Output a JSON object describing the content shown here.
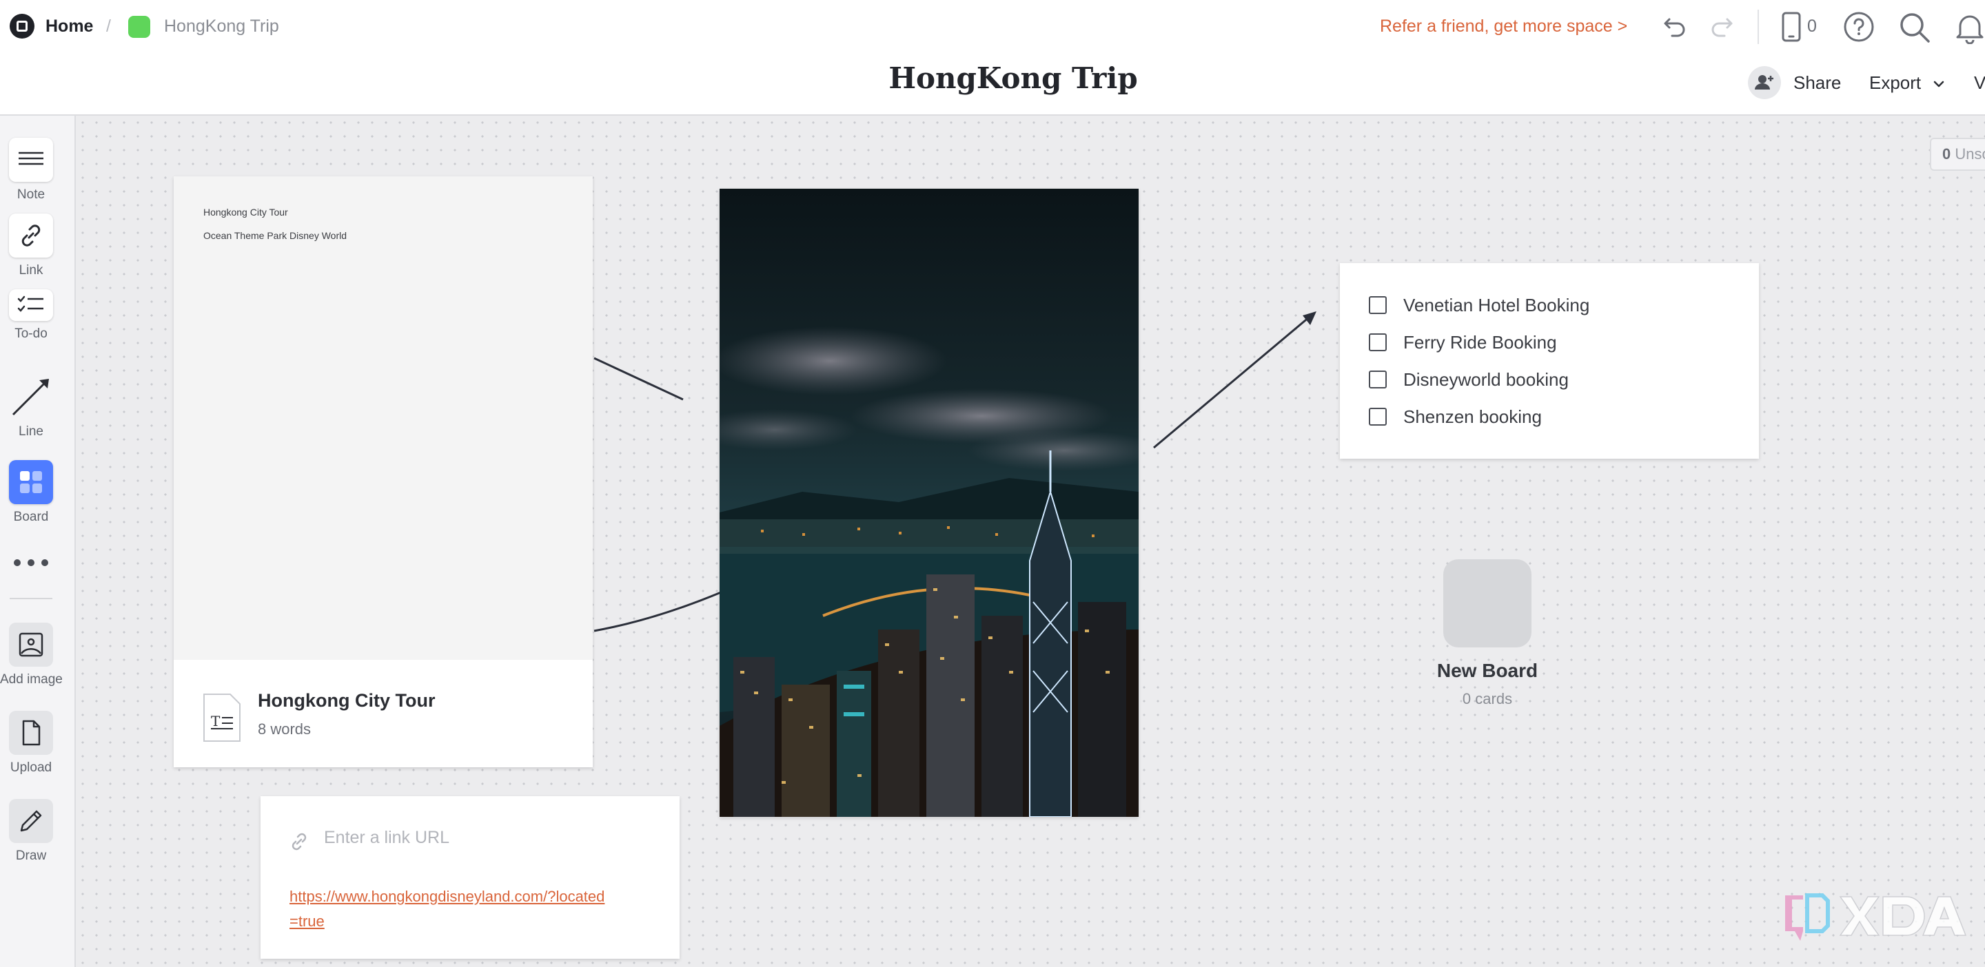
{
  "breadcrumb": {
    "home": "Home",
    "separator": "/",
    "board": "HongKong Trip",
    "board_color": "#5fd55a"
  },
  "header": {
    "refer": "Refer a friend, get more space >",
    "device_count": "0",
    "title": "HongKong Trip",
    "share": "Share",
    "export": "Export",
    "view": "V"
  },
  "sidebar": {
    "tools": [
      {
        "label": "Note",
        "icon": "note-icon"
      },
      {
        "label": "Link",
        "icon": "link-icon"
      },
      {
        "label": "To-do",
        "icon": "todo-icon"
      },
      {
        "label": "Line",
        "icon": "line-icon"
      },
      {
        "label": "Board",
        "icon": "board-icon"
      },
      {
        "label": "Add image",
        "icon": "image-icon"
      },
      {
        "label": "Upload",
        "icon": "file-icon"
      },
      {
        "label": "Draw",
        "icon": "pencil-icon"
      }
    ]
  },
  "canvas": {
    "unsorted_count": "0",
    "unsorted_label": "Unsorted",
    "doc": {
      "lines": [
        "Hongkong City Tour",
        "Ocean Theme Park Disney World"
      ],
      "title": "Hongkong City Tour",
      "subtitle": "8 words"
    },
    "link": {
      "placeholder": "Enter a link URL",
      "url": "https://www.hongkongdisneyland.com/?located=true"
    },
    "todo": {
      "items": [
        "Venetian Hotel Booking",
        "Ferry Ride Booking",
        "Disneyworld booking",
        "Shenzen booking"
      ]
    },
    "board": {
      "name": "New Board",
      "count": "0 cards"
    }
  },
  "colors": {
    "accent": "#d9643a",
    "board_blue": "#4f7cff"
  }
}
